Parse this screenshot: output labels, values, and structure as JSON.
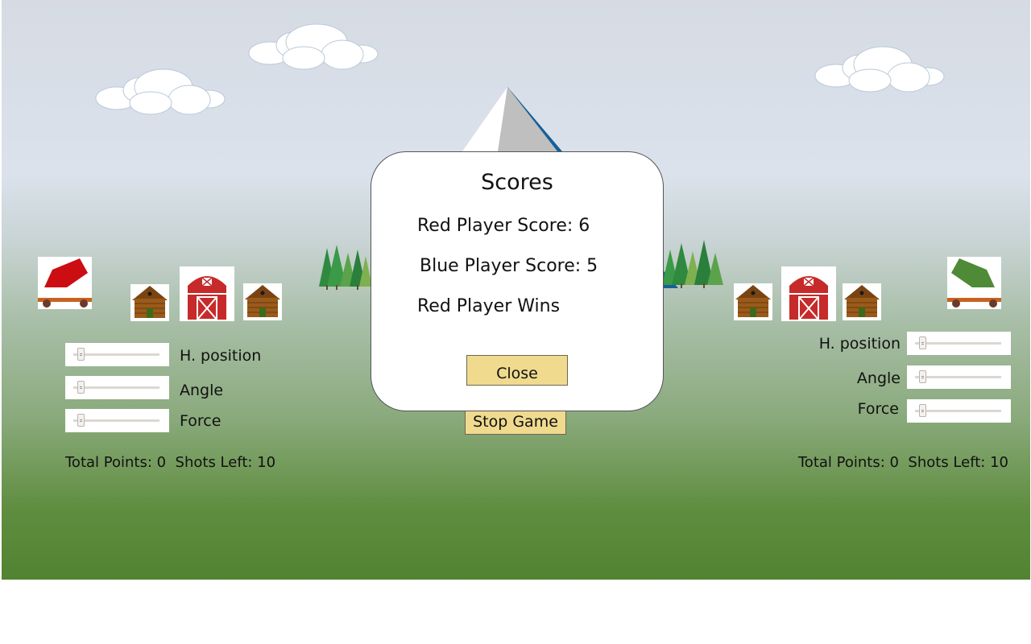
{
  "scene": {
    "description_icons": [
      "cloud-icon",
      "mountain-icon",
      "pine-tree-icon",
      "cabin-icon",
      "barn-icon",
      "cannon-icon"
    ]
  },
  "left_player": {
    "color": "#cc0d12",
    "hpos_label": "H. position",
    "angle_label": "Angle",
    "force_label": "Force",
    "hpos_value": 0.05,
    "angle_value": 0.05,
    "force_value": 0.05,
    "total_points_label": "Total Points:",
    "total_points": "0",
    "shots_left_label": "Shots Left:",
    "shots_left": "10"
  },
  "right_player": {
    "color": "#4f8a37",
    "hpos_label": "H. position",
    "angle_label": "Angle",
    "force_label": "Force",
    "hpos_value": 0.05,
    "angle_value": 0.05,
    "force_value": 0.05,
    "total_points_label": "Total Points:",
    "total_points": "0",
    "shots_left_label": "Shots Left:",
    "shots_left": "10"
  },
  "controls": {
    "stop_game_label": "Stop Game"
  },
  "dialog": {
    "title": "Scores",
    "red_score": "Red Player Score: 6",
    "blue_score": "Blue Player Score: 5",
    "winner": "Red Player Wins",
    "close_label": "Close"
  },
  "colors": {
    "button_bg": "#efda8e",
    "sky_top": "#d6dbe3",
    "grass_bottom": "#518331"
  }
}
